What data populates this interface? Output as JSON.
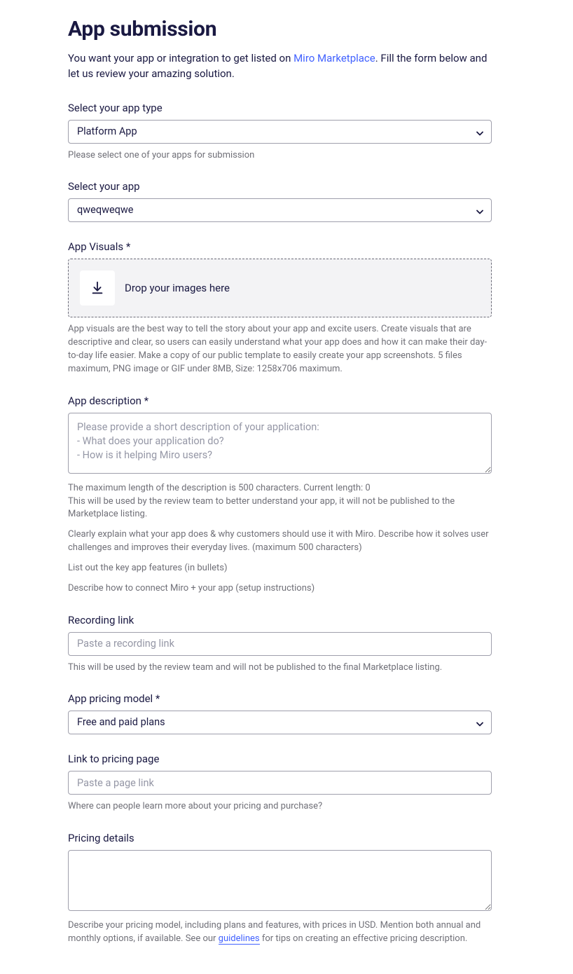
{
  "title": "App submission",
  "intro_pre": "You want your app or integration to get listed on ",
  "intro_link": "Miro Marketplace",
  "intro_post": ". Fill the form below and let us review your amazing solution.",
  "app_type": {
    "label": "Select your app type",
    "value": "Platform App",
    "helper": "Please select one of your apps for submission"
  },
  "app": {
    "label": "Select your app",
    "value": "qweqweqwe"
  },
  "visuals": {
    "label": "App Visuals *",
    "drop_text": "Drop your images here",
    "helper": "App visuals are the best way to tell the story about your app and excite users. Create visuals that are descriptive and clear, so users can easily understand what your app does and how it can make their day-to-day life easier. Make a copy of our public template to easily create your app screenshots. 5 files maximum, PNG image or GIF under 8MB, Size: 1258x706 maximum."
  },
  "description": {
    "label": "App description *",
    "placeholder": "Please provide a short description of your application:\n- What does your application do?\n- How is it helping Miro users?",
    "helper1": "The maximum length of the description is 500 characters. Current length: 0\nThis will be used by the review team to better understand your app, it will not be published to the Marketplace listing.",
    "helper2": "Clearly explain what your app does & why customers should use it with Miro. Describe how it solves user challenges and improves their everyday lives. (maximum 500 characters)",
    "helper3": "List out the key app features (in bullets)",
    "helper4": "Describe how to connect Miro + your app (setup instructions)"
  },
  "recording": {
    "label": "Recording link",
    "placeholder": "Paste a recording link",
    "helper": "This will be used by the review team and will not be published to the final Marketplace listing."
  },
  "pricing_model": {
    "label": "App pricing model *",
    "value": "Free and paid plans"
  },
  "pricing_page": {
    "label": "Link to pricing page",
    "placeholder": "Paste a page link",
    "helper": "Where can people learn more about your pricing and purchase?"
  },
  "pricing_details": {
    "label": "Pricing details",
    "helper_pre": "Describe your pricing model, including plans and features, with prices in USD. Mention both annual and monthly options, if available. See our ",
    "helper_link": "guidelines",
    "helper_post": " for tips on creating an effective pricing description."
  }
}
